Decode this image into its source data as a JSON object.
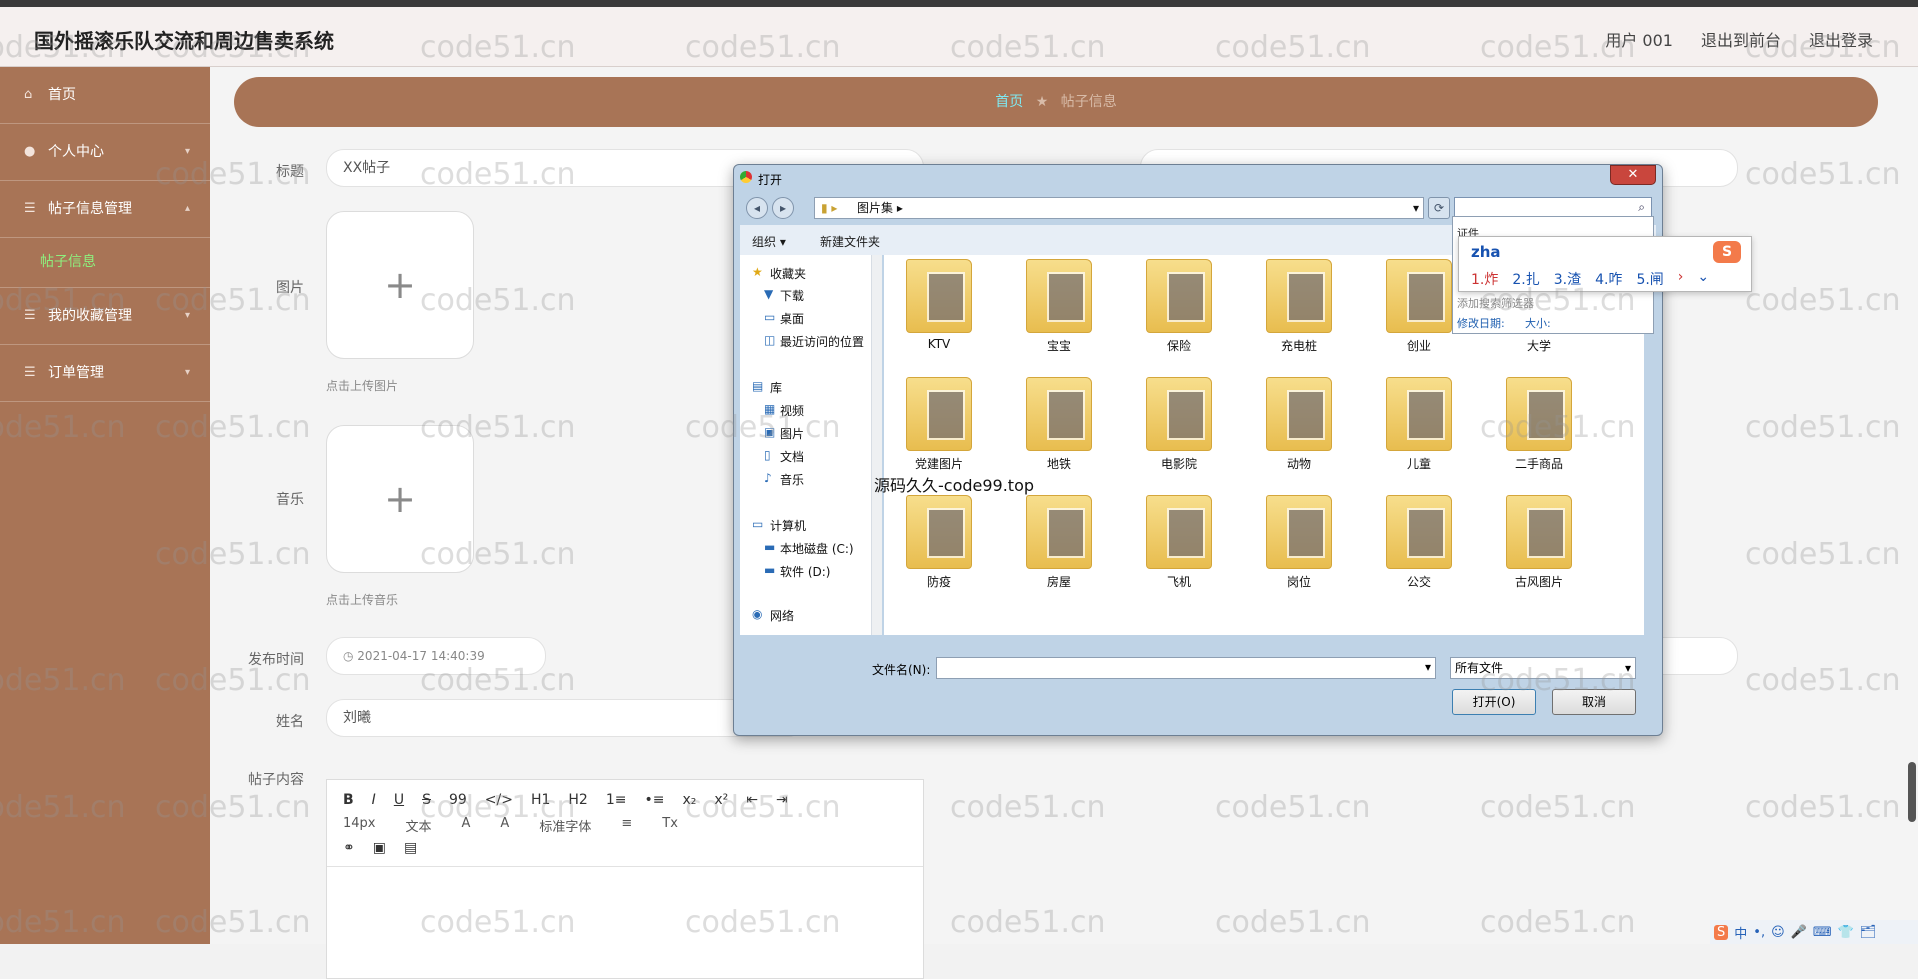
{
  "header": {
    "title": "国外摇滚乐队交流和周边售卖系统",
    "nav": [
      "用户 001",
      "退出到前台",
      "退出登录"
    ]
  },
  "sidebar": {
    "items": [
      {
        "label": "首页",
        "icon": "home-icon"
      },
      {
        "label": "个人中心",
        "icon": "user-icon"
      },
      {
        "label": "帖子信息管理",
        "icon": "list-icon"
      },
      {
        "label": "帖子信息",
        "sub": true
      },
      {
        "label": "我的收藏管理",
        "icon": "list-icon"
      },
      {
        "label": "订单管理",
        "icon": "list-icon"
      }
    ]
  },
  "breadcrumb": {
    "home": "首页",
    "sep": "★",
    "current": "帖子信息"
  },
  "form": {
    "title_label": "标题",
    "title_value": "XX帖子",
    "image_label": "图片",
    "image_hint": "点击上传图片",
    "music_label": "音乐",
    "music_hint": "点击上传音乐",
    "time_label": "发布时间",
    "time_value": "2021-04-17 14:40:39",
    "name_label": "姓名",
    "name_value": "刘曦",
    "content_label": "帖子内容",
    "editor_row1": [
      "B",
      "I",
      "U",
      "S",
      "99",
      "</>",
      "H1",
      "H2",
      "1≡",
      "•≡",
      "x₂",
      "x²",
      "⇤",
      "⇥"
    ],
    "editor_row2": [
      "14px",
      "文本",
      "A",
      "A",
      "标准字体",
      "≡",
      "Tx"
    ],
    "editor_row3": [
      "link",
      "image",
      "video"
    ],
    "plus": "+"
  },
  "dialog": {
    "title": "打开",
    "path": "图片集",
    "toolbar": [
      "组织 ▾",
      "新建文件夹"
    ],
    "tree": [
      "收藏夹",
      "下载",
      "桌面",
      "最近访问的位置",
      "库",
      "视频",
      "图片",
      "文档",
      "音乐",
      "计算机",
      "本地磁盘 (C:)",
      "软件 (D:)",
      "网络"
    ],
    "folders": [
      "KTV",
      "宝宝",
      "保险",
      "充电桩",
      "创业",
      "大学",
      "党建图片",
      "地铁",
      "电影院",
      "动物",
      "儿童",
      "二手商品",
      "防疫",
      "房屋",
      "飞机",
      "岗位",
      "公交",
      "古风图片"
    ],
    "filename_label": "文件名(N):",
    "filetype": "所有文件",
    "open_btn": "打开(O)",
    "cancel_btn": "取消",
    "search_drop": {
      "top": "证件",
      "filter": "添加搜索筛选器",
      "date": "修改日期:",
      "size": "大小:"
    }
  },
  "ime": {
    "pinyin": "zha",
    "candidates": [
      "1.炸",
      "2.扎",
      "3.渣",
      "4.咋",
      "5.闸"
    ],
    "logo": "S"
  },
  "overlay_text": "源码久久-code99.top",
  "watermark": "code51.cn",
  "taskbar": [
    "S",
    "中",
    "•,",
    "☺",
    "🎤",
    "⌨",
    "👕",
    "🗂"
  ]
}
